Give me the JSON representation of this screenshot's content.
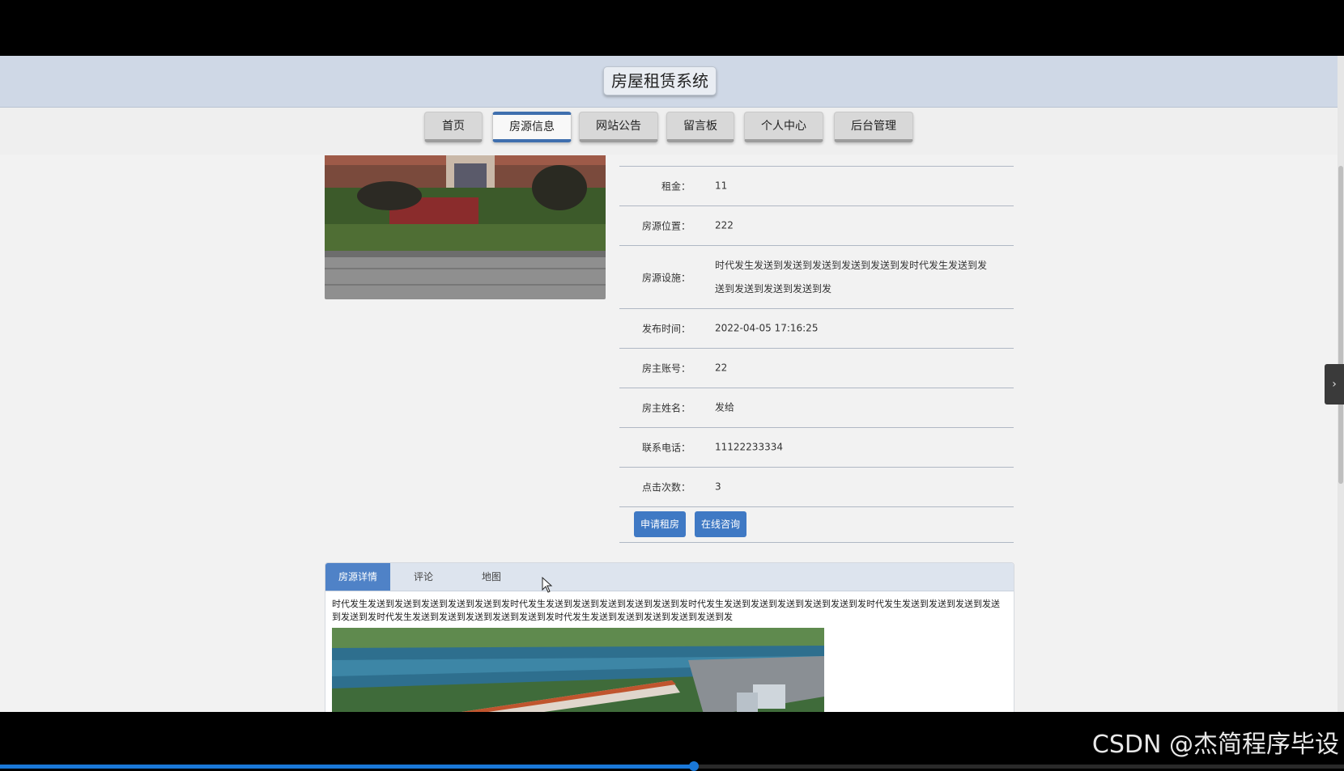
{
  "header": {
    "title": "房屋租赁系统"
  },
  "nav": {
    "items": [
      "首页",
      "房源信息",
      "网站公告",
      "留言板",
      "个人中心",
      "后台管理"
    ],
    "active": "房源信息"
  },
  "details": {
    "rows": [
      {
        "label": "租金：",
        "value": "11"
      },
      {
        "label": "房源位置：",
        "value": "222"
      },
      {
        "label": "房源设施：",
        "value": "时代发生发送到发送到发送到发送到发送到发时代发生发送到发送到发送到发送到发送到发"
      },
      {
        "label": "发布时间：",
        "value": "2022-04-05 17:16:25"
      },
      {
        "label": "房主账号：",
        "value": "22"
      },
      {
        "label": "房主姓名：",
        "value": "发给"
      },
      {
        "label": "联系电话：",
        "value": "11122233334"
      },
      {
        "label": "点击次数：",
        "value": "3"
      }
    ],
    "apply_button": "申请租房",
    "consult_button": "在线咨询"
  },
  "tabs": {
    "items": [
      "房源详情",
      "评论",
      "地图"
    ],
    "active": "房源详情",
    "content_text": "时代发生发送到发送到发送到发送到发送到发时代发生发送到发送到发送到发送到发送到发时代发生发送到发送到发送到发送到发送到发时代发生发送到发送到发送到发送到发送到发时代发生发送到发送到发送到发送到发送到发时代发生发送到发送到发送到发送到发送到发"
  },
  "watermark": "CSDN @杰简程序毕设",
  "video": {
    "progress": 0.516
  },
  "icons": {
    "side_handle": "chevron-right-icon",
    "cursor": "mouse-pointer-icon"
  },
  "colors": {
    "accent": "#3f79c4",
    "header_bg": "#cfd8e6",
    "active_tab": "#4f82c7"
  }
}
